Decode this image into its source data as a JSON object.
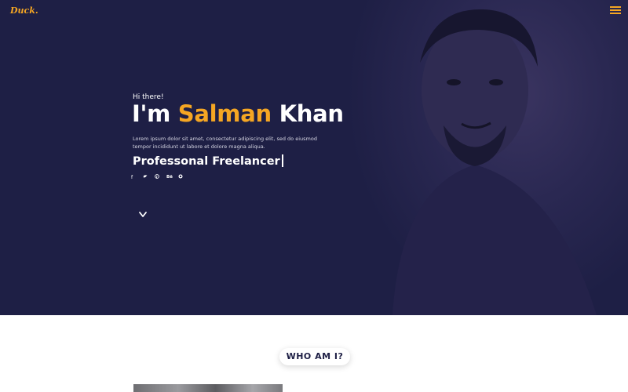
{
  "brand": {
    "logo": "Duck."
  },
  "header": {
    "menu_icon": "hamburger-menu-icon"
  },
  "hero": {
    "greeting": "Hi there!",
    "headline_prefix": "I'm",
    "headline_first_name": "Salman",
    "headline_last_name": "Khan",
    "intro": "Lorem ipsum dolor sit amet, consectetur adipiscing elit, sed do eiusmod tempor incididunt ut labore et dolore magna aliqua.",
    "role": "Professonal Freelancer",
    "socials": [
      {
        "icon": "facebook-icon",
        "glyph": "f"
      },
      {
        "icon": "twitter-icon",
        "glyph": "🐦"
      },
      {
        "icon": "pinterest-icon",
        "glyph": "℗"
      },
      {
        "icon": "behance-icon",
        "glyph": "Bē"
      },
      {
        "icon": "github-icon",
        "glyph": "●"
      }
    ],
    "scroll_icon": "chevron-down-icon"
  },
  "about": {
    "section_title": "WHO AM I?"
  },
  "colors": {
    "accent": "#f5a623",
    "hero_bg": "#1e1f45",
    "text_light": "#ffffff"
  }
}
